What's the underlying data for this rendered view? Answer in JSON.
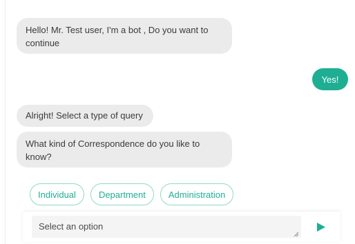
{
  "messages": [
    {
      "from": "bot",
      "text": "Hello! Mr. Test user, I'm a bot , Do you want to continue"
    },
    {
      "from": "user",
      "text": "Yes!"
    },
    {
      "from": "bot",
      "text": "Alright! Select a type of query"
    },
    {
      "from": "bot",
      "text": "What kind of Correspondence do you like to know?"
    }
  ],
  "options": [
    "Individual",
    "Department",
    "Administration"
  ],
  "composer": {
    "placeholder": "Select an option",
    "send_icon": "send-arrow-icon"
  },
  "colors": {
    "accent": "#1fae93",
    "bot_bubble": "#ebebeb",
    "option_border": "#8fd9c8"
  }
}
